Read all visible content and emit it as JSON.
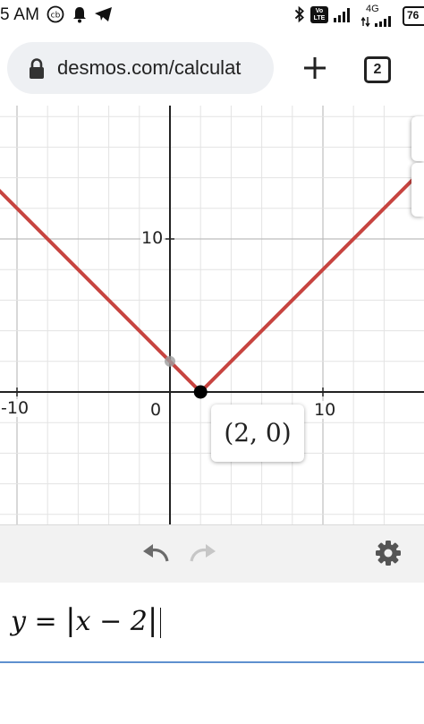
{
  "status_bar": {
    "time": "5 AM",
    "volte_label": "Vo LTE",
    "network_label": "4G",
    "battery": "76"
  },
  "browser": {
    "url": "desmos.com/calculat",
    "tab_count": "2"
  },
  "graph": {
    "x_ticks": [
      "-10",
      "0",
      "10"
    ],
    "y_ticks": [
      "10"
    ],
    "tooltip": "(2, 0)",
    "curve_color": "#c74440",
    "point_color": "#000000"
  },
  "chart_data": {
    "type": "line",
    "series": [
      {
        "x": [
          -12,
          2,
          17
        ],
        "y": [
          14,
          0,
          15
        ]
      }
    ],
    "points": [
      {
        "x": 2,
        "y": 0
      },
      {
        "x": 0,
        "y": 2
      }
    ],
    "xlim": [
      -10.3,
      15.6
    ],
    "ylim": [
      -8.5,
      18.3
    ]
  },
  "expression": {
    "lhs": "y",
    "eq": " = ",
    "bar_open": "|",
    "body": "x − 2",
    "bar_close": "|"
  }
}
